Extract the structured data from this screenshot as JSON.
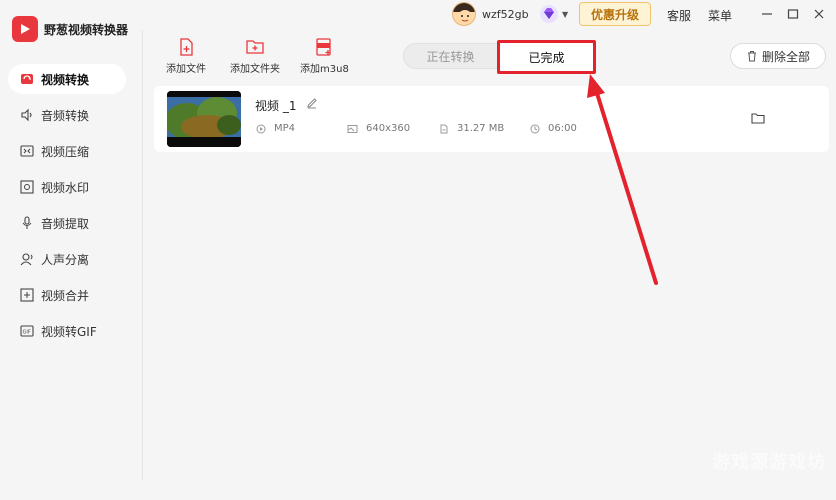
{
  "app": {
    "title": "野葱视频转换器"
  },
  "header": {
    "username": "wzf52gb",
    "upgrade_label": "优惠升级",
    "service_label": "客服",
    "menu_label": "菜单"
  },
  "sidebar": {
    "items": [
      {
        "label": "视频转换",
        "active": true
      },
      {
        "label": "音频转换"
      },
      {
        "label": "视频压缩"
      },
      {
        "label": "视频水印"
      },
      {
        "label": "音频提取"
      },
      {
        "label": "人声分离"
      },
      {
        "label": "视频合并"
      },
      {
        "label": "视频转GIF"
      }
    ]
  },
  "toolbar": {
    "add_file": "添加文件",
    "add_folder": "添加文件夹",
    "add_m3u8": "添加m3u8",
    "delete_all": "删除全部"
  },
  "tabs": {
    "converting": "正在转换",
    "completed": "已完成"
  },
  "file": {
    "name": "视频 _1",
    "format": "MP4",
    "resolution": "640x360",
    "size": "31.27 MB",
    "duration": "06:00"
  },
  "watermark": "游戏源游戏坊",
  "colors": {
    "accent_red": "#e3222b",
    "brand_red": "#e8383d",
    "upgrade_gold": "#b8730b"
  }
}
